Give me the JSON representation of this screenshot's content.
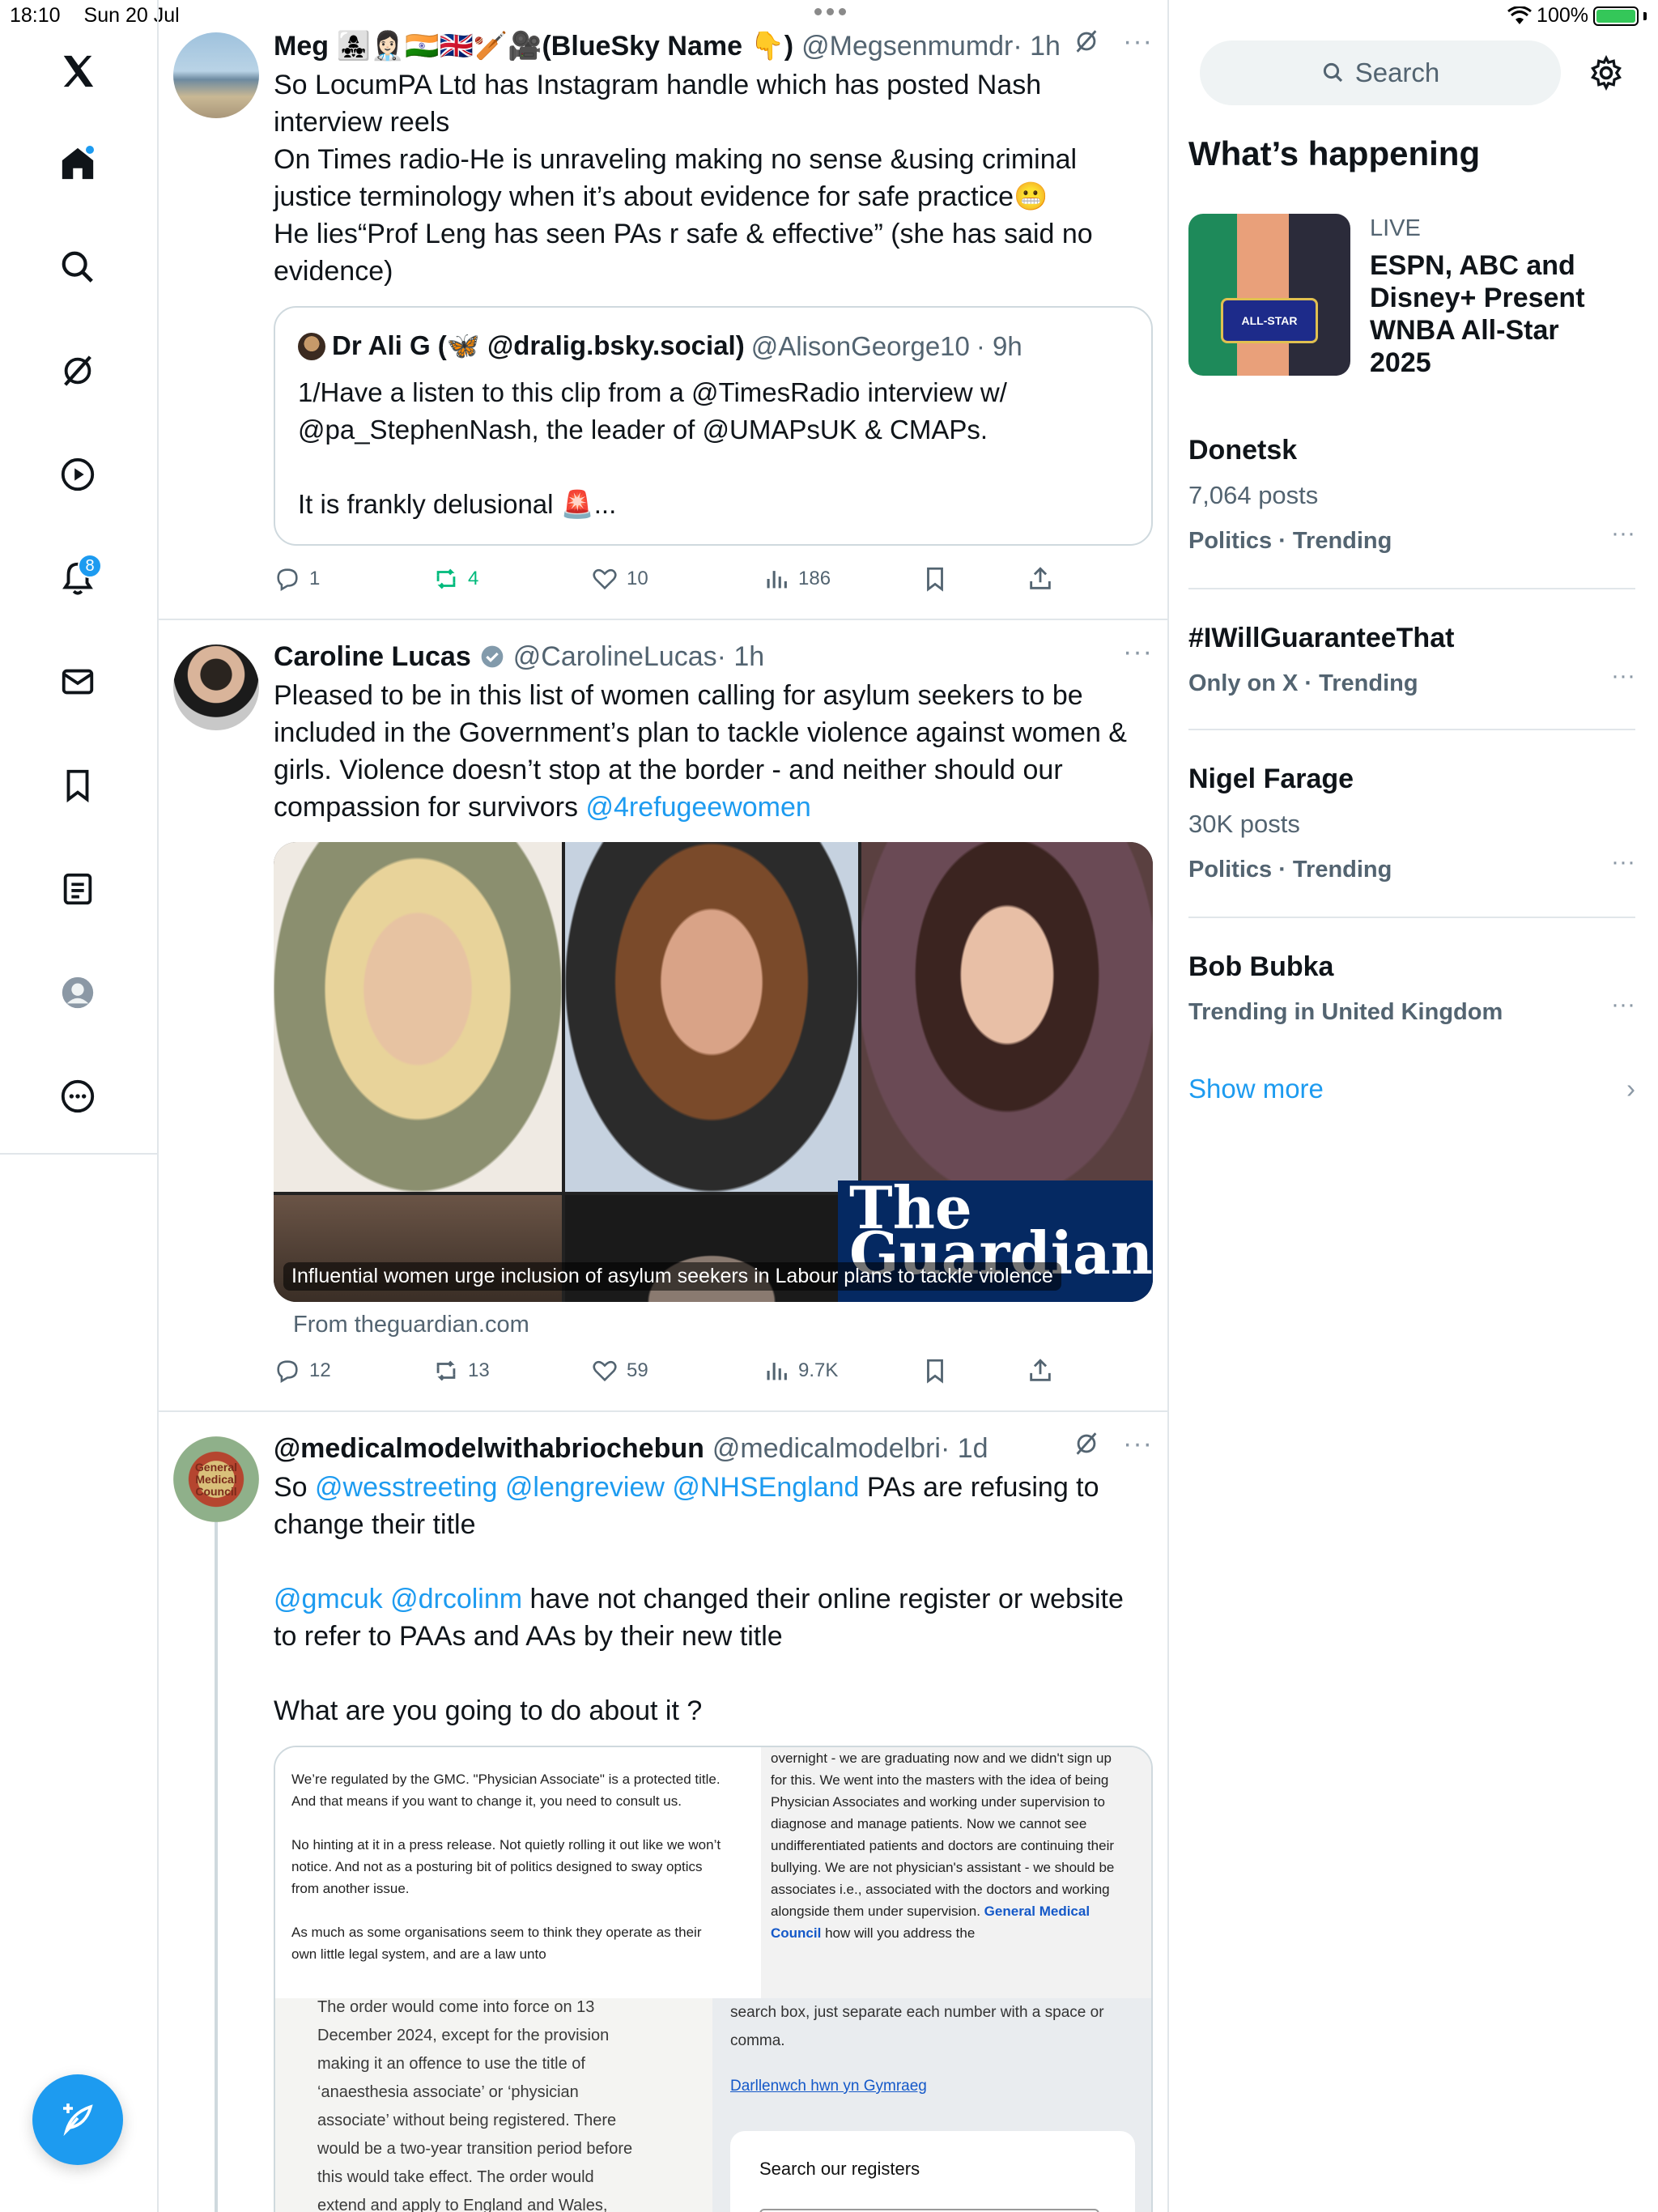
{
  "status_bar": {
    "time": "18:10",
    "date": "Sun 20 Jul",
    "battery": "100%",
    "battery_level": 1.0
  },
  "nav": {
    "items": [
      {
        "name": "x-logo-icon"
      },
      {
        "name": "home-icon",
        "dot": true
      },
      {
        "name": "search-icon"
      },
      {
        "name": "grok-icon"
      },
      {
        "name": "video-icon"
      },
      {
        "name": "notifications-icon",
        "badge": "8"
      },
      {
        "name": "messages-icon"
      },
      {
        "name": "bookmarks-icon"
      },
      {
        "name": "lists-icon"
      },
      {
        "name": "profile-icon"
      },
      {
        "name": "more-icon"
      }
    ],
    "compose": "compose-icon"
  },
  "posts": [
    {
      "author": "Meg 👩‍👧‍👧👩🏻‍⚕️🇮🇳🇬🇧🏏🎥(BlueSky Name 👇)",
      "handle": "@Megsenmumdr",
      "time": "· 1h",
      "text": "So LocumPA Ltd has Instagram handle which has posted Nash interview reels\nOn Times radio-He is unraveling making no sense &using criminal justice terminology when it’s about evidence for safe practice😬\nHe lies“Prof Leng has seen PAs r safe & effective” (she has said no evidence)",
      "quote": {
        "author": "Dr Ali G (🦋 @dralig.bsky.social)",
        "handle": "@AlisonGeorge10",
        "time": "· 9h",
        "text": "1/Have a listen to this clip from a @TimesRadio interview w/ @pa_StephenNash, the leader of @UMAPsUK & CMAPs.\n\nIt is frankly delusional 🚨..."
      },
      "stats": {
        "replies": "1",
        "reposts": "4",
        "likes": "10",
        "views": "186"
      }
    },
    {
      "author": "Caroline Lucas",
      "handle": "@CarolineLucas",
      "time": "· 1h",
      "text_main": "Pleased to be in this list of women calling for asylum seekers to be included in the Government’s plan to tackle violence against women & girls. Violence doesn’t stop at the border - and neither should our compassion for survivors ",
      "text_mention": "@4refugeewomen",
      "link": {
        "caption": "Influential women urge inclusion of asylum seekers in Labour plans to tackle violence",
        "source": "From theguardian.com",
        "brand_line1": "The",
        "brand_line2": "Guardian"
      },
      "stats": {
        "replies": "12",
        "reposts": "13",
        "likes": "59",
        "views": "9.7K"
      }
    },
    {
      "author": "@medicalmodelwithabriochebun",
      "handle": "@medicalmodelbri",
      "time": "· 1d",
      "avatar_text": "General Medical Council",
      "text_parts": {
        "p1_prefix": "So ",
        "p1_mentions": "@wesstreeting @lengreview @NHSEngland",
        "p1_suffix": " PAs are refusing to change their title",
        "p2_mentions": "@gmcuk @drcolinm",
        "p2_suffix": " have not changed their online register or website to refer to PAAs and AAs by their new title",
        "p3": "What are you going to do about it ?"
      },
      "media": {
        "doc1": "We’re regulated by the GMC. \"Physician Associate\" is a protected title. And that means if you want to change it, you need to consult us.\n\nNo hinting at it in a press release. Not quietly rolling it out like we won’t notice. And not as a posturing bit of politics designed to sway optics from another issue.\n\nAs much as some organisations seem to think they operate as their own little legal system, and are a law unto",
        "doc2_text": "overnight - we are graduating now and we didn't sign up for this. We went into the masters with the idea of being Physician Associates and working under supervision to diagnose and manage patients. Now we cannot see undifferentiated patients and doctors are continuing their bullying. We are not physician's assistant - we should be associates i.e., associated with the doctors and working alongside them under supervision. ",
        "doc2_link": "General Medical Council",
        "doc2_tail": " how will you address the",
        "doc3": "The order would come into force on 13\nDecember 2024, except for the provision\nmaking it an offence to use the title of\n‘anaesthesia associate’ or ‘physician\nassociate’ without being registered. There\nwould be a two-year transition period before\nthis would take effect. The order would\nextend and apply to England and Wales,",
        "doc4": "search box, just separate each number with a space or comma.",
        "doc4_link": "Darllenwch hwn yn Gymraeg",
        "doc4_box": "Search our registers"
      }
    }
  ],
  "sidebar": {
    "search_placeholder": "Search",
    "heading": "What’s happening",
    "featured": {
      "live": "LIVE",
      "title": "ESPN, ABC and Disney+ Present WNBA All-Star 2025",
      "img_text": "ALL-STAR"
    },
    "trends": [
      {
        "name": "Donetsk",
        "posts": "7,064 posts",
        "meta": "Politics · Trending"
      },
      {
        "name": "#IWillGuaranteeThat",
        "posts": "",
        "meta": "Only on X · Trending"
      },
      {
        "name": "Nigel Farage",
        "posts": "30K posts",
        "meta": "Politics · Trending"
      },
      {
        "name": "Bob Bubka",
        "posts": "",
        "meta": "Trending in United Kingdom"
      }
    ],
    "show_more": "Show more"
  },
  "colors": {
    "accent": "#1d9bf0",
    "repost_active": "#00ba7c",
    "text": "#0f1419",
    "muted": "#536471"
  }
}
